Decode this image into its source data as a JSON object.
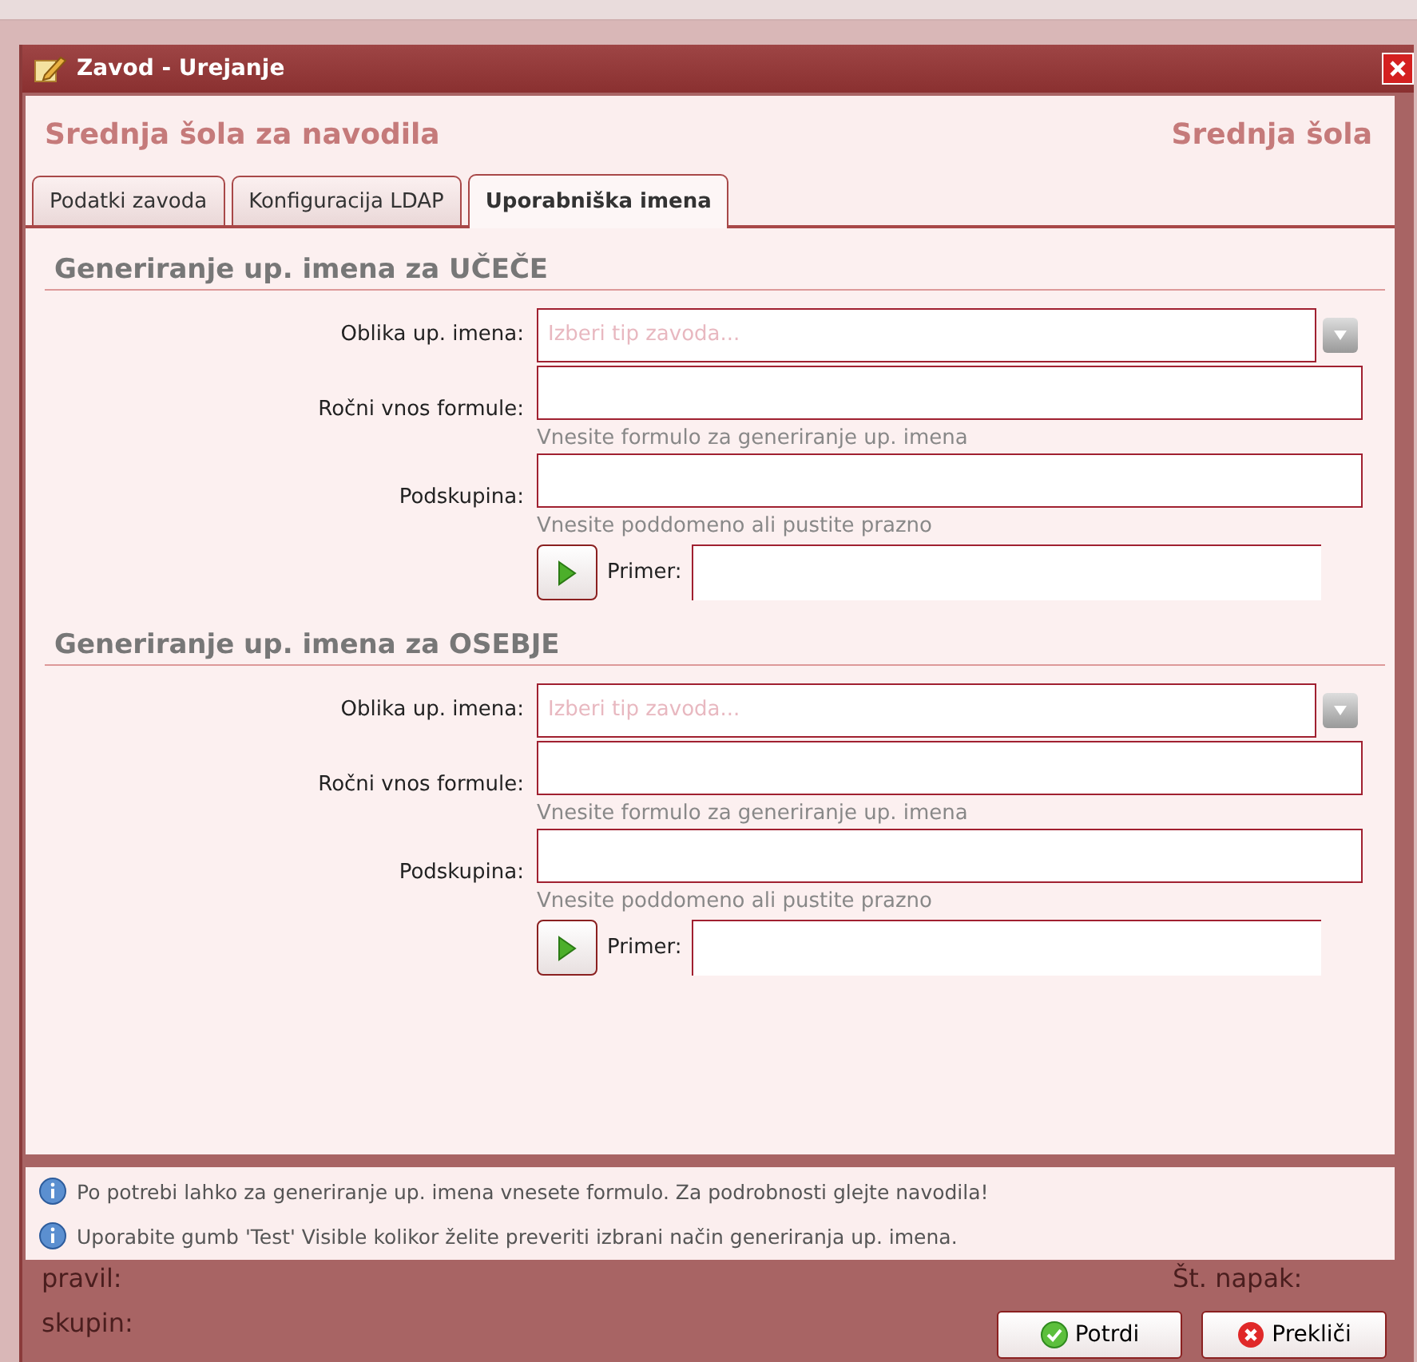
{
  "window": {
    "title": "Zavod - Urejanje"
  },
  "header": {
    "title": "Srednja šola za navodila",
    "type": "Srednja šola"
  },
  "tabs": [
    {
      "label": "Podatki zavoda",
      "selected": false
    },
    {
      "label": "Konfiguracija LDAP",
      "selected": false
    },
    {
      "label": "Uporabniška imena",
      "selected": true
    }
  ],
  "sections": [
    {
      "title": "Generiranje up. imena za UČEČE",
      "fields": [
        {
          "kind": "select",
          "label": "Oblika up. imena:",
          "placeholder": "Izberi tip zavoda..."
        },
        {
          "kind": "text",
          "label": "Ročni vnos formule:",
          "hint": "Vnesite formulo za generiranje up. imena"
        },
        {
          "kind": "text",
          "label": "Podskupina:",
          "hint": "Vnesite poddomeno ali pustite prazno"
        },
        {
          "kind": "example",
          "label": "Primer:"
        }
      ]
    },
    {
      "title": "Generiranje up. imena za OSEBJE",
      "fields": [
        {
          "kind": "select",
          "label": "Oblika up. imena:",
          "placeholder": "Izberi tip zavoda..."
        },
        {
          "kind": "text",
          "label": "Ročni vnos formule:",
          "hint": "Vnesite formulo za generiranje up. imena"
        },
        {
          "kind": "text",
          "label": "Podskupina:",
          "hint": "Vnesite poddomeno ali pustite prazno"
        },
        {
          "kind": "example",
          "label": "Primer:"
        }
      ]
    }
  ],
  "info": [
    "Po potrebi lahko za generiranje up. imena vnesete formulo. Za podrobnosti glejte navodila!",
    "Uporabite gumb 'Test' Visible kolikor želite preveriti izbrani način generiranja up. imena."
  ],
  "buttons": [
    {
      "kind": "confirm",
      "label": "Potrdi"
    },
    {
      "kind": "cancel",
      "label": "Prekliči"
    }
  ],
  "backdrop": [
    "pravil:",
    "skupin:",
    "Št. napak:"
  ]
}
